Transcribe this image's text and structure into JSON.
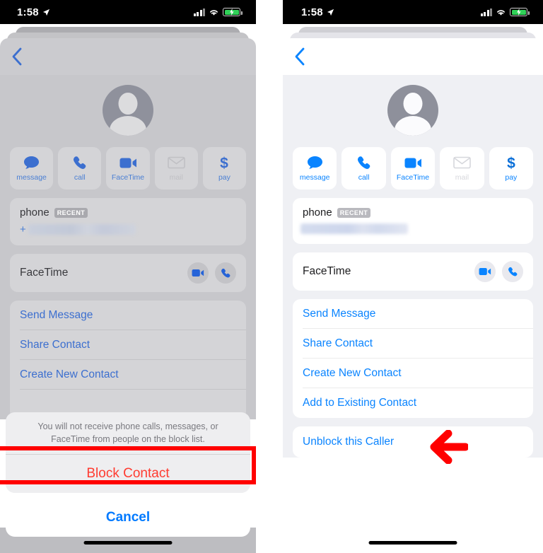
{
  "status_bar": {
    "time": "1:58",
    "location_icon": "location-arrow-icon",
    "signal_icon": "cellular-signal-icon",
    "wifi_icon": "wifi-icon",
    "battery_icon": "battery-charging-icon"
  },
  "left_panel": {
    "name": "contact-card-with-block-action-sheet",
    "back_icon": "back-chevron-icon",
    "avatar_icon": "contact-avatar-placeholder-icon",
    "actions": [
      {
        "label": "message",
        "icon": "message-bubble-icon",
        "disabled": false
      },
      {
        "label": "call",
        "icon": "phone-handset-icon",
        "disabled": false
      },
      {
        "label": "FaceTime",
        "icon": "video-camera-icon",
        "disabled": false
      },
      {
        "label": "mail",
        "icon": "envelope-icon",
        "disabled": true
      },
      {
        "label": "pay",
        "icon": "dollar-sign-icon",
        "disabled": false
      }
    ],
    "phone_section": {
      "label": "phone",
      "badge": "RECENT",
      "number_prefix": "+",
      "number_value": ""
    },
    "facetime_row": {
      "label": "FaceTime",
      "video_icon": "video-camera-icon",
      "audio_icon": "phone-handset-icon"
    },
    "list_items": [
      {
        "label": "Send Message"
      },
      {
        "label": "Share Contact"
      },
      {
        "label": "Create New Contact"
      }
    ],
    "action_sheet": {
      "message": "You will not receive phone calls, messages, or FaceTime from people on the block list.",
      "destructive_label": "Block Contact",
      "cancel_label": "Cancel"
    },
    "annotation": {
      "type": "highlight-box",
      "color": "#ff0000",
      "targets": "Block Contact"
    }
  },
  "right_panel": {
    "name": "contact-card-blocked-state",
    "back_icon": "back-chevron-icon",
    "avatar_icon": "contact-avatar-placeholder-icon",
    "actions": [
      {
        "label": "message",
        "icon": "message-bubble-icon",
        "disabled": false
      },
      {
        "label": "call",
        "icon": "phone-handset-icon",
        "disabled": false
      },
      {
        "label": "FaceTime",
        "icon": "video-camera-icon",
        "disabled": false
      },
      {
        "label": "mail",
        "icon": "envelope-icon",
        "disabled": true
      },
      {
        "label": "pay",
        "icon": "dollar-sign-icon",
        "disabled": false
      }
    ],
    "phone_section": {
      "label": "phone",
      "badge": "RECENT",
      "number_value": ""
    },
    "facetime_row": {
      "label": "FaceTime",
      "video_icon": "video-camera-icon",
      "audio_icon": "phone-handset-icon"
    },
    "list_items": [
      {
        "label": "Send Message"
      },
      {
        "label": "Share Contact"
      },
      {
        "label": "Create New Contact"
      },
      {
        "label": "Add to Existing Contact"
      }
    ],
    "unblock_label": "Unblock this Caller",
    "annotation": {
      "type": "left-pointing-arrow",
      "color": "#ff0000",
      "targets": "Unblock this Caller"
    }
  }
}
